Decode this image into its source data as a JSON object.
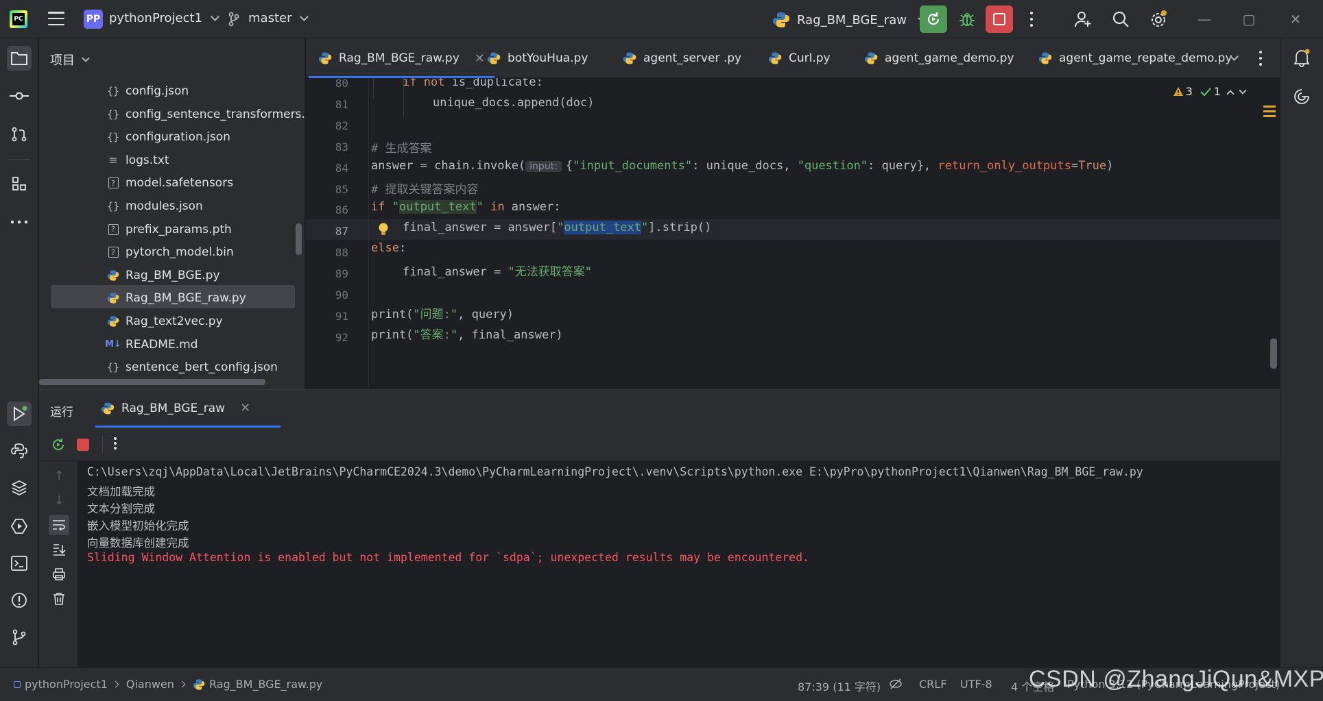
{
  "titlebar": {
    "project_badge": "PP",
    "project_name": "pythonProject1",
    "branch": "master",
    "run_config": "Rag_BM_BGE_raw"
  },
  "project_panel": {
    "title": "项目",
    "files": [
      {
        "name": "config.json",
        "icon": "json-icon"
      },
      {
        "name": "config_sentence_transformers.json",
        "icon": "json-icon"
      },
      {
        "name": "configuration.json",
        "icon": "json-icon"
      },
      {
        "name": "logs.txt",
        "icon": "text-file-icon"
      },
      {
        "name": "model.safetensors",
        "icon": "unknown-file-icon"
      },
      {
        "name": "modules.json",
        "icon": "json-icon"
      },
      {
        "name": "prefix_params.pth",
        "icon": "unknown-file-icon"
      },
      {
        "name": "pytorch_model.bin",
        "icon": "unknown-file-icon"
      },
      {
        "name": "Rag_BM_BGE.py",
        "icon": "python-icon"
      },
      {
        "name": "Rag_BM_BGE_raw.py",
        "icon": "python-icon",
        "selected": true
      },
      {
        "name": "Rag_text2vec.py",
        "icon": "python-icon"
      },
      {
        "name": "README.md",
        "icon": "markdown-icon"
      },
      {
        "name": "sentence_bert_config.json",
        "icon": "json-icon"
      }
    ]
  },
  "tabs": [
    {
      "label": "Rag_BM_BGE_raw.py",
      "active": true
    },
    {
      "label": "botYouHua.py"
    },
    {
      "label": "agent_server .py"
    },
    {
      "label": "Curl.py"
    },
    {
      "label": "agent_game_demo.py"
    },
    {
      "label": "agent_game_repate_demo.py"
    }
  ],
  "editor": {
    "inspections": {
      "warnings": "3",
      "ok": "1"
    },
    "line_numbers": [
      "80",
      "81",
      "82",
      "83",
      "84",
      "85",
      "86",
      "87",
      "88",
      "89",
      "90",
      "91",
      "92"
    ],
    "lines": {
      "l80_kw1": "if",
      "l80_kw2": "not",
      "l80_rest": " is_duplicate:",
      "l81": "unique_docs.append(doc)",
      "l83": "# 生成答案",
      "l84_a": "answer = chain.invoke(",
      "l84_hint": "input:",
      "l84_b": "{",
      "l84_s1": "\"input_documents\"",
      "l84_c": ": unique_docs, ",
      "l84_s2": "\"question\"",
      "l84_d": ": query}, ",
      "l84_p": "return_only_outputs",
      "l84_e": "=",
      "l84_t": "True",
      "l84_f": ")",
      "l85": "# 提取关键答案内容",
      "l86_kw": "if",
      "l86_q1": "\"",
      "l86_s": "output_text",
      "l86_q2": "\"",
      "l86_kw2": "in",
      "l86_rest": " answer:",
      "l87_a": "final_answer = answer[",
      "l87_q1": "\"",
      "l87_s": "output_text",
      "l87_q2": "\"",
      "l87_b": "].strip()",
      "l88": "else",
      "l88_colon": ":",
      "l89_a": "final_answer = ",
      "l89_s": "\"无法获取答案\"",
      "l91_a": "print(",
      "l91_s": "\"问题:\"",
      "l91_b": ", query)",
      "l92_a": "print(",
      "l92_s": "\"答案:\"",
      "l92_b": ", final_answer)"
    }
  },
  "run_window": {
    "title": "运行",
    "tab": "Rag_BM_BGE_raw",
    "console": [
      {
        "text": "C:\\Users\\zqj\\AppData\\Local\\JetBrains\\PyCharmCE2024.3\\demo\\PyCharmLearningProject\\.venv\\Scripts\\python.exe E:\\pyPro\\pythonProject1\\Qianwen\\Rag_BM_BGE_raw.py",
        "type": "normal"
      },
      {
        "text": "文档加载完成",
        "type": "normal"
      },
      {
        "text": "文本分割完成",
        "type": "normal"
      },
      {
        "text": "嵌入模型初始化完成",
        "type": "normal"
      },
      {
        "text": "向量数据库创建完成",
        "type": "normal"
      },
      {
        "text": "Sliding Window Attention is enabled but not implemented for `sdpa`; unexpected results may be encountered.",
        "type": "error"
      }
    ]
  },
  "statusbar": {
    "breadcrumb": [
      "pythonProject1",
      "Qianwen",
      "Rag_BM_BGE_raw.py"
    ],
    "position": "87:39 (11 字符)",
    "line_sep": "CRLF",
    "encoding": "UTF-8",
    "indent": "4 个空格",
    "interpreter": "Python 3.12 (PyCharmLearningProject)"
  },
  "watermark": "CSDN @ZhangJiQun&MXP",
  "colors": {
    "accent": "#3574f0",
    "run_green": "#4e9a56",
    "stop_red": "#d44a4a",
    "error": "#f75464",
    "string": "#6aab73",
    "keyword": "#cf8e6d"
  }
}
